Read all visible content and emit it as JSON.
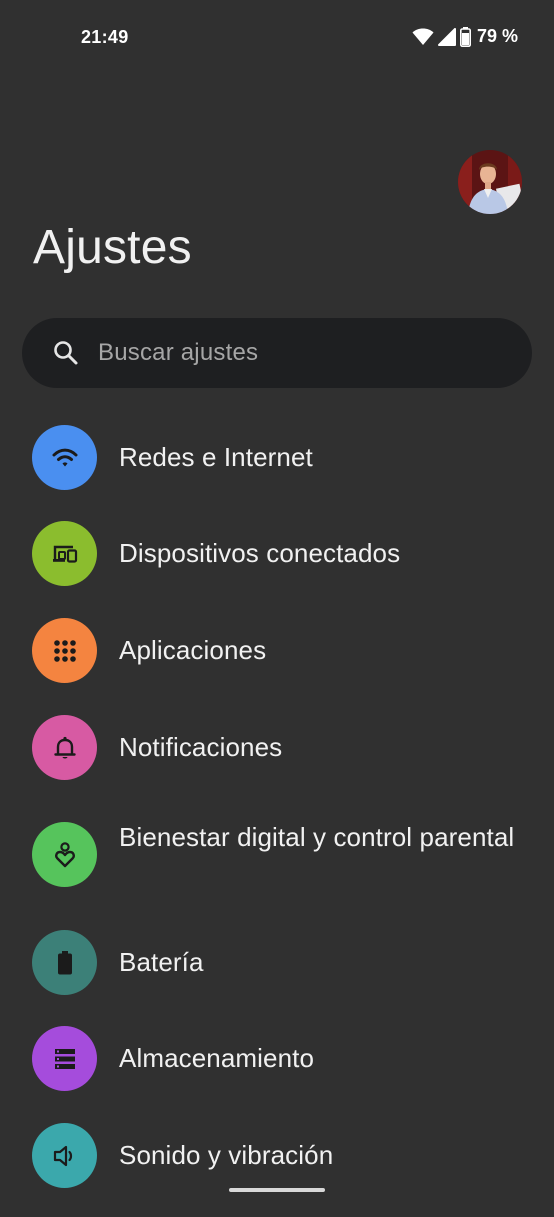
{
  "status_bar": {
    "time": "21:49",
    "battery_percent": "79 %",
    "icons": [
      "wifi-icon",
      "signal-icon",
      "battery-icon"
    ]
  },
  "header": {
    "title": "Ajustes",
    "avatar": "profile-avatar"
  },
  "search": {
    "placeholder": "Buscar ajustes",
    "icon": "search-icon"
  },
  "settings": {
    "items": [
      {
        "label": "Redes e Internet",
        "icon": "wifi-icon",
        "color": "#4a8ff0"
      },
      {
        "label": "Dispositivos conectados",
        "icon": "devices-icon",
        "color": "#8bbd2e"
      },
      {
        "label": "Aplicaciones",
        "icon": "apps-grid-icon",
        "color": "#f48440"
      },
      {
        "label": "Notificaciones",
        "icon": "bell-icon",
        "color": "#d75aa3"
      },
      {
        "label": "Bienestar digital y control parental",
        "icon": "wellbeing-heart-icon",
        "color": "#56c45c"
      },
      {
        "label": "Batería",
        "icon": "battery-icon",
        "color": "#3c8078"
      },
      {
        "label": "Almacenamiento",
        "icon": "storage-icon",
        "color": "#a54cdc"
      },
      {
        "label": "Sonido y vibración",
        "icon": "speaker-icon",
        "color": "#3ba8ac"
      }
    ]
  }
}
